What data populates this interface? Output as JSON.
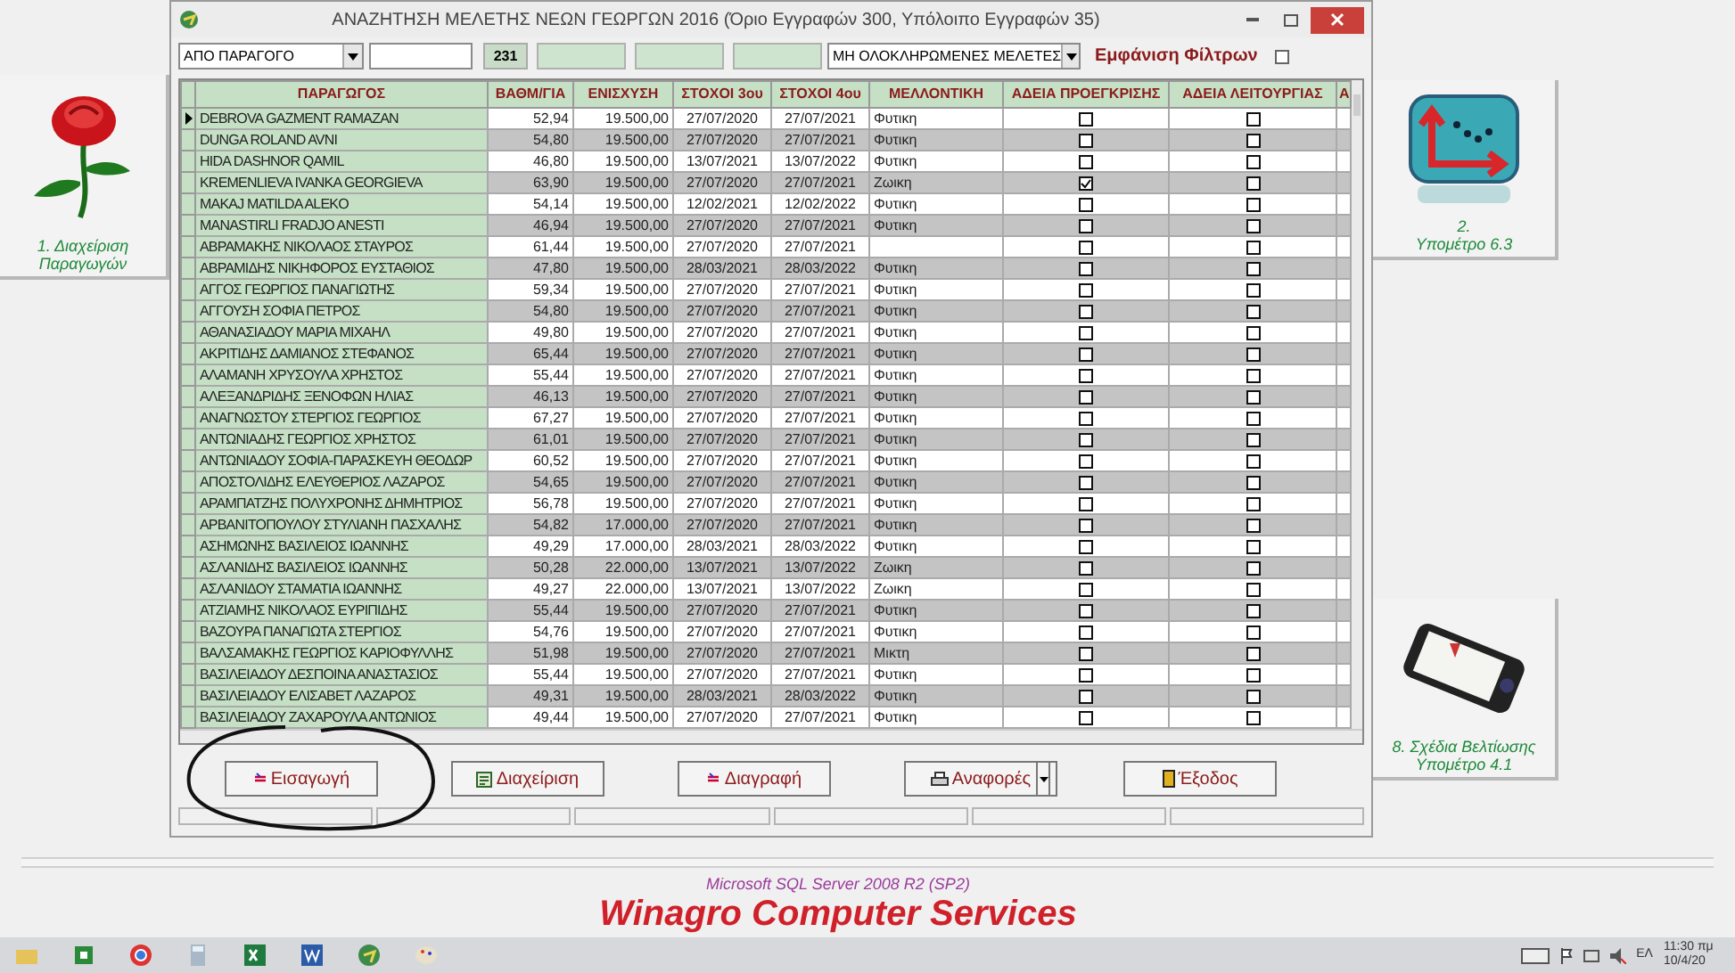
{
  "window": {
    "title": "ΑΝΑΖΗΤΗΣΗ ΜΕΛΕΤΗΣ ΝΕΩΝ ΓΕΩΡΓΩΝ 2016 (Όριο Εγγραφών 300, Υπόλοιπο Εγγραφών 35)"
  },
  "filters": {
    "search_by": "ΑΠΟ ΠΑΡΑΓΟΓΟ",
    "count": "231",
    "status_filter": "ΜΗ ΟΛΟΚΛΗΡΩΜΕΝΕΣ ΜΕΛΕΤΕΣ",
    "show_filters": {
      "label": "Εμφάνιση Φίλτρων",
      "checked": false
    }
  },
  "table": {
    "columns": [
      "ΠΑΡΑΓΩΓΟΣ",
      "ΒΑΘΜ/ΓΙΑ",
      "ΕΝΙΣΧΥΣΗ",
      "ΣΤΟΧΟΙ 3ου",
      "ΣΤΟΧΟΙ 4ου",
      "ΜΕΛΛΟΝΤΙΚΗ",
      "ΑΔΕΙΑ ΠΡΟΕΓΚΡΙΣΗΣ",
      "ΑΔΕΙΑ ΛΕΙΤΟΥΡΓΙΑΣ",
      "Α"
    ],
    "rows": [
      {
        "current": true,
        "name": "DEBROVA GAZMENT RAMAZAN",
        "grade": "52,94",
        "subsidy": "19.500,00",
        "goals_3": "27/07/2020",
        "goals_4": "27/07/2021",
        "future": "Φυτικη",
        "preapproval": false,
        "license": false
      },
      {
        "current": false,
        "name": "DUNGA ROLAND AVNI",
        "grade": "54,80",
        "subsidy": "19.500,00",
        "goals_3": "27/07/2020",
        "goals_4": "27/07/2021",
        "future": "Φυτικη",
        "preapproval": false,
        "license": false
      },
      {
        "current": false,
        "name": "HIDA DASHNOR QAMIL",
        "grade": "46,80",
        "subsidy": "19.500,00",
        "goals_3": "13/07/2021",
        "goals_4": "13/07/2022",
        "future": "Φυτικη",
        "preapproval": false,
        "license": false
      },
      {
        "current": false,
        "name": "KREMENLIEVA IVANKA GEORGIEVA",
        "grade": "63,90",
        "subsidy": "19.500,00",
        "goals_3": "27/07/2020",
        "goals_4": "27/07/2021",
        "future": "Ζωικη",
        "preapproval": true,
        "license": false
      },
      {
        "current": false,
        "name": "MAKAJ MATILDA ALEKO",
        "grade": "54,14",
        "subsidy": "19.500,00",
        "goals_3": "12/02/2021",
        "goals_4": "12/02/2022",
        "future": "Φυτικη",
        "preapproval": false,
        "license": false
      },
      {
        "current": false,
        "name": "MANASTIRLI FRADJO ANESTI",
        "grade": "46,94",
        "subsidy": "19.500,00",
        "goals_3": "27/07/2020",
        "goals_4": "27/07/2021",
        "future": "Φυτικη",
        "preapproval": false,
        "license": false
      },
      {
        "current": false,
        "name": "ΑΒΡΑΜΑΚΗΣ ΝΙΚΟΛΑΟΣ ΣΤΑΥΡΟΣ",
        "grade": "61,44",
        "subsidy": "19.500,00",
        "goals_3": "27/07/2020",
        "goals_4": "27/07/2021",
        "preapproval": false,
        "license": false
      },
      {
        "current": false,
        "name": "ΑΒΡΑΜΙΔΗΣ ΝΙΚΗΦΟΡΟΣ ΕΥΣΤΑΘΙΟΣ",
        "grade": "47,80",
        "subsidy": "19.500,00",
        "goals_3": "28/03/2021",
        "goals_4": "28/03/2022",
        "future": "Φυτικη",
        "preapproval": false,
        "license": false
      },
      {
        "current": false,
        "name": "ΑΓΓΟΣ ΓΕΩΡΓΙΟΣ ΠΑΝΑΓΙΩΤΗΣ",
        "grade": "59,34",
        "subsidy": "19.500,00",
        "goals_3": "27/07/2020",
        "goals_4": "27/07/2021",
        "future": "Φυτικη",
        "preapproval": false,
        "license": false
      },
      {
        "current": false,
        "name": "ΑΓΓΟΥΣΗ ΣΟΦΙΑ ΠΕΤΡΟΣ",
        "grade": "54,80",
        "subsidy": "19.500,00",
        "goals_3": "27/07/2020",
        "goals_4": "27/07/2021",
        "future": "Φυτικη",
        "preapproval": false,
        "license": false
      },
      {
        "current": false,
        "name": "ΑΘΑΝΑΣΙΑΔΟΥ ΜΑΡΙΑ ΜΙΧΑΗΛ",
        "grade": "49,80",
        "subsidy": "19.500,00",
        "goals_3": "27/07/2020",
        "goals_4": "27/07/2021",
        "future": "Φυτικη",
        "preapproval": false,
        "license": false
      },
      {
        "current": false,
        "name": "ΑΚΡΙΤΙΔΗΣ ΔΑΜΙΑΝΟΣ ΣΤΕΦΑΝΟΣ",
        "grade": "65,44",
        "subsidy": "19.500,00",
        "goals_3": "27/07/2020",
        "goals_4": "27/07/2021",
        "future": "Φυτικη",
        "preapproval": false,
        "license": false
      },
      {
        "current": false,
        "name": "ΑΛΑΜΑΝΗ ΧΡΥΣΟΥΛΑ ΧΡΗΣΤΟΣ",
        "grade": "55,44",
        "subsidy": "19.500,00",
        "goals_3": "27/07/2020",
        "goals_4": "27/07/2021",
        "future": "Φυτικη",
        "preapproval": false,
        "license": false
      },
      {
        "current": false,
        "name": "ΑΛΕΞΑΝΔΡΙΔΗΣ ΞΕΝΟΦΩΝ ΗΛΙΑΣ",
        "grade": "46,13",
        "subsidy": "19.500,00",
        "goals_3": "27/07/2020",
        "goals_4": "27/07/2021",
        "future": "Φυτικη",
        "preapproval": false,
        "license": false
      },
      {
        "current": false,
        "name": "ΑΝΑΓΝΩΣΤΟΥ ΣΤΕΡΓΙΟΣ ΓΕΩΡΓΙΟΣ",
        "grade": "67,27",
        "subsidy": "19.500,00",
        "goals_3": "27/07/2020",
        "goals_4": "27/07/2021",
        "future": "Φυτικη",
        "preapproval": false,
        "license": false
      },
      {
        "current": false,
        "name": "ΑΝΤΩΝΙΑΔΗΣ ΓΕΩΡΓΙΟΣ ΧΡΗΣΤΟΣ",
        "grade": "61,01",
        "subsidy": "19.500,00",
        "goals_3": "27/07/2020",
        "goals_4": "27/07/2021",
        "future": "Φυτικη",
        "preapproval": false,
        "license": false
      },
      {
        "current": false,
        "name": "ΑΝΤΩΝΙΑΔΟΥ ΣΟΦΙΑ-ΠΑΡΑΣΚΕΥΗ ΘΕΟΔΩΡ",
        "grade": "60,52",
        "subsidy": "19.500,00",
        "goals_3": "27/07/2020",
        "goals_4": "27/07/2021",
        "future": "Φυτικη",
        "preapproval": false,
        "license": false
      },
      {
        "current": false,
        "name": "ΑΠΟΣΤΟΛΙΔΗΣ ΕΛΕΥΘΕΡΙΟΣ ΛΑΖΑΡΟΣ",
        "grade": "54,65",
        "subsidy": "19.500,00",
        "goals_3": "27/07/2020",
        "goals_4": "27/07/2021",
        "future": "Φυτικη",
        "preapproval": false,
        "license": false
      },
      {
        "current": false,
        "name": "ΑΡΑΜΠΑΤΖΗΣ ΠΟΛΥΧΡΟΝΗΣ ΔΗΜΗΤΡΙΟΣ",
        "grade": "56,78",
        "subsidy": "19.500,00",
        "goals_3": "27/07/2020",
        "goals_4": "27/07/2021",
        "future": "Φυτικη",
        "preapproval": false,
        "license": false
      },
      {
        "current": false,
        "name": "ΑΡΒΑΝΙΤΟΠΟΥΛΟΥ ΣΤΥΛΙΑΝΗ ΠΑΣΧΑΛΗΣ",
        "grade": "54,82",
        "subsidy": "17.000,00",
        "goals_3": "27/07/2020",
        "goals_4": "27/07/2021",
        "future": "Φυτικη",
        "preapproval": false,
        "license": false
      },
      {
        "current": false,
        "name": "ΑΣΗΜΩΝΗΣ ΒΑΣΙΛΕΙΟΣ ΙΩΑΝΝΗΣ",
        "grade": "49,29",
        "subsidy": "17.000,00",
        "goals_3": "28/03/2021",
        "goals_4": "28/03/2022",
        "future": "Φυτικη",
        "preapproval": false,
        "license": false
      },
      {
        "current": false,
        "name": "ΑΣΛΑΝΙΔΗΣ ΒΑΣΙΛΕΙΟΣ ΙΩΑΝΝΗΣ",
        "grade": "50,28",
        "subsidy": "22.000,00",
        "goals_3": "13/07/2021",
        "goals_4": "13/07/2022",
        "future": "Ζωικη",
        "preapproval": false,
        "license": false
      },
      {
        "current": false,
        "name": "ΑΣΛΑΝΙΔΟΥ ΣΤΑΜΑΤΙΑ ΙΩΑΝΝΗΣ",
        "grade": "49,27",
        "subsidy": "22.000,00",
        "goals_3": "13/07/2021",
        "goals_4": "13/07/2022",
        "future": "Ζωικη",
        "preapproval": false,
        "license": false
      },
      {
        "current": false,
        "name": "ΑΤΖΙΑΜΗΣ ΝΙΚΟΛΑΟΣ ΕΥΡΙΠΙΔΗΣ",
        "grade": "55,44",
        "subsidy": "19.500,00",
        "goals_3": "27/07/2020",
        "goals_4": "27/07/2021",
        "future": "Φυτικη",
        "preapproval": false,
        "license": false
      },
      {
        "current": false,
        "name": "ΒΑΖΟΥΡΑ ΠΑΝΑΓΙΩΤΑ ΣΤΕΡΓΙΟΣ",
        "grade": "54,76",
        "subsidy": "19.500,00",
        "goals_3": "27/07/2020",
        "goals_4": "27/07/2021",
        "future": "Φυτικη",
        "preapproval": false,
        "license": false
      },
      {
        "current": false,
        "name": "ΒΑΛΣΑΜΑΚΗΣ ΓΕΩΡΓΙΟΣ ΚΑΡΙΟΦΥΛΛΗΣ",
        "grade": "51,98",
        "subsidy": "19.500,00",
        "goals_3": "27/07/2020",
        "goals_4": "27/07/2021",
        "future": "Μικτη",
        "preapproval": false,
        "license": false
      },
      {
        "current": false,
        "name": "ΒΑΣΙΛΕΙΑΔΟΥ ΔΕΣΠΟΙΝΑ ΑΝΑΣΤΑΣΙΟΣ",
        "grade": "55,44",
        "subsidy": "19.500,00",
        "goals_3": "27/07/2020",
        "goals_4": "27/07/2021",
        "future": "Φυτικη",
        "preapproval": false,
        "license": false
      },
      {
        "current": false,
        "name": "ΒΑΣΙΛΕΙΑΔΟΥ ΕΛΙΣΑΒΕΤ ΛΑΖΑΡΟΣ",
        "grade": "49,31",
        "subsidy": "19.500,00",
        "goals_3": "28/03/2021",
        "goals_4": "28/03/2022",
        "future": "Φυτικη",
        "preapproval": false,
        "license": false
      },
      {
        "current": false,
        "name": "ΒΑΣΙΛΕΙΑΔΟΥ ΖΑΧΑΡΟΥΛΑ ΑΝΤΩΝΙΟΣ",
        "grade": "49,44",
        "subsidy": "19.500,00",
        "goals_3": "27/07/2020",
        "goals_4": "27/07/2021",
        "future": "Φυτικη",
        "preapproval": false,
        "license": false
      }
    ]
  },
  "buttons": [
    {
      "label": "Εισαγωγή",
      "has_menu": false
    },
    {
      "label": "Διαχείριση",
      "has_menu": false
    },
    {
      "label": "Διαγραφή",
      "has_menu": false
    },
    {
      "label": "Αναφορές",
      "has_menu": true
    },
    {
      "label": "Έξοδος",
      "has_menu": false
    }
  ],
  "tiles": [
    {
      "kind": "rose",
      "lines": [
        "1. Διαχείριση",
        "Παραγωγών"
      ]
    },
    {
      "kind": "chart",
      "lines": [
        "2.",
        "Υπομέτρο 6.3"
      ]
    },
    {
      "kind": "phone",
      "lines": [
        "8. Σχέδια Βελτίωσης",
        "Υπομέτρο 4.1"
      ]
    }
  ],
  "footer": {
    "server": "Microsoft SQL Server 2008 R2 (SP2)",
    "company": "Winagro Computer Services"
  },
  "taskbar": {
    "language": "ΕΛ",
    "time": "11:30 πμ",
    "date": "10/4/20"
  }
}
